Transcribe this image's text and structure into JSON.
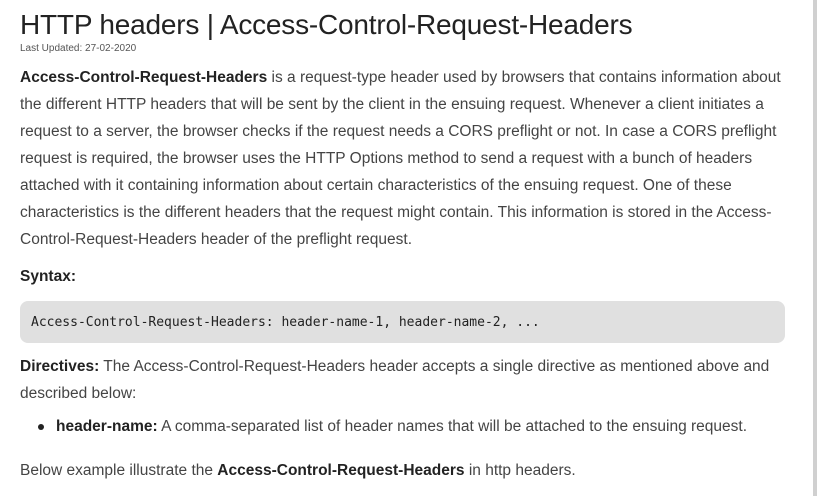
{
  "article": {
    "title": "HTTP headers | Access-Control-Request-Headers",
    "last_updated": "Last Updated: 27-02-2020",
    "intro_bold": "Access-Control-Request-Headers",
    "intro_rest": " is a request-type header used by browsers that contains information about the different HTTP headers that will be sent by the client in the ensuing request. Whenever a client initiates a request to a server, the browser checks if the request needs a CORS preflight or not. In case a CORS preflight request is required, the browser uses the HTTP Options method to send a request with a bunch of headers attached with it containing information about certain characteristics of the ensuing request. One of these characteristics is the different headers that the request might contain. This information is stored in the Access-Control-Request-Headers header of the preflight request.",
    "syntax_label": "Syntax:",
    "syntax_code": "Access-Control-Request-Headers: header-name-1, header-name-2, ...",
    "directives_label": "Directives:",
    "directives_text": " The Access-Control-Request-Headers header accepts a single directive as mentioned above and described below:",
    "directive_items": [
      {
        "name": "header-name:",
        "description": " A comma-separated list of header names that will be attached to the ensuing request."
      }
    ],
    "example_prefix": "Below example illustrate the ",
    "example_bold": "Access-Control-Request-Headers",
    "example_suffix": " in http headers."
  }
}
